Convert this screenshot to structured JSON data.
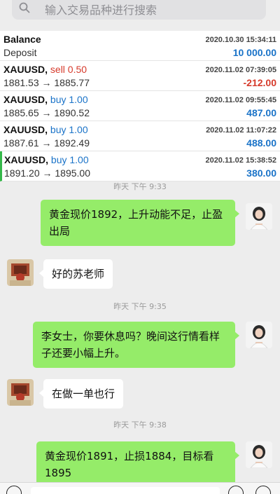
{
  "search": {
    "placeholder": "输入交易品种进行搜索"
  },
  "balance": {
    "title": "Balance",
    "subtitle": "Deposit",
    "time": "2020.10.30 15:34:11",
    "amount": "10 000.00"
  },
  "trades": [
    {
      "symbol": "XAUUSD,",
      "direction": "sell 0.50",
      "side": "sell",
      "prices": "1881.53 → 1885.77",
      "time": "2020.11.02 07:39:05",
      "profit": "-212.00"
    },
    {
      "symbol": "XAUUSD,",
      "direction": "buy 1.00",
      "side": "buy",
      "prices": "1885.65 → 1890.52",
      "time": "2020.11.02 09:55:45",
      "profit": "487.00"
    },
    {
      "symbol": "XAUUSD,",
      "direction": "buy 1.00",
      "side": "buy",
      "prices": "1887.61 → 1892.49",
      "time": "2020.11.02 11:07:22",
      "profit": "488.00"
    },
    {
      "symbol": "XAUUSD,",
      "direction": "buy 1.00",
      "side": "buy",
      "prices": "1891.20 → 1895.00",
      "time": "2020.11.02 15:38:52",
      "profit": "380.00"
    }
  ],
  "chat": {
    "timestamps": [
      "昨天 下午 9:33",
      "昨天 下午 9:35",
      "昨天 下午 9:38"
    ],
    "messages": [
      {
        "from": "me",
        "text": "黄金现价1892，上升动能不足，止盈出局"
      },
      {
        "from": "them",
        "text": "好的苏老师"
      },
      {
        "from": "me",
        "text": "李女士，你要休息吗？晚间这行情看样子还要小幅上升。"
      },
      {
        "from": "them",
        "text": "在做一单也行"
      },
      {
        "from": "me",
        "text": "黄金现价1891，止损1884，目标看1895"
      }
    ]
  },
  "icons": {
    "search": "search-icon",
    "voice": "voice-icon",
    "emoji": "emoji-icon",
    "plus": "plus-icon"
  },
  "colors": {
    "my_bubble": "#95ec69",
    "their_bubble": "#ffffff",
    "sell": "#d63a2b",
    "buy": "#1a73c8",
    "highlight_bar": "#35b84a"
  }
}
